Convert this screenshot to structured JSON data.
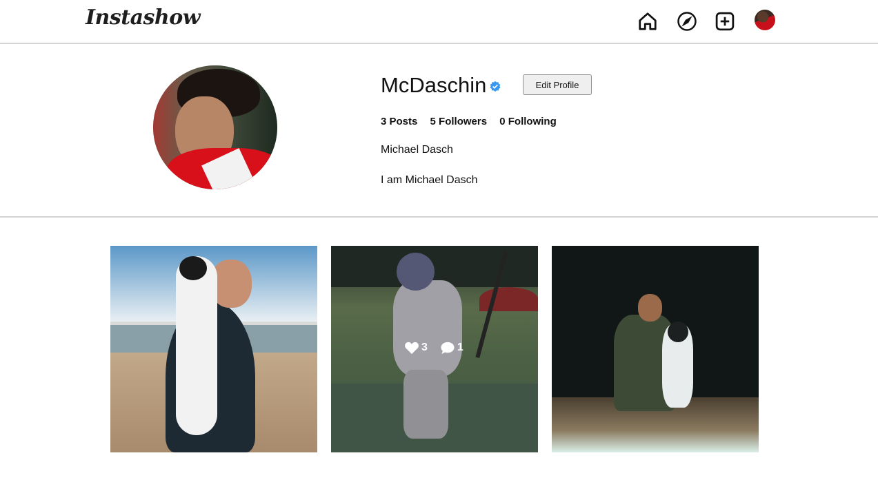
{
  "app": {
    "logo": "Instashow"
  },
  "nav": {
    "items": [
      {
        "name": "home",
        "icon": "home-icon"
      },
      {
        "name": "explore",
        "icon": "compass-icon"
      },
      {
        "name": "new-post",
        "icon": "plus-square-icon"
      },
      {
        "name": "profile",
        "icon": "avatar"
      }
    ]
  },
  "profile": {
    "username": "McDaschin",
    "verified": true,
    "edit_label": "Edit Profile",
    "stats": {
      "posts": "3 Posts",
      "followers": "5 Followers",
      "following": "0 Following"
    },
    "full_name": "Michael Dasch",
    "bio": "I am Michael Dasch"
  },
  "posts": [
    {
      "id": "post-1",
      "hovered": false
    },
    {
      "id": "post-2",
      "hovered": true,
      "likes": "3",
      "comments": "1"
    },
    {
      "id": "post-3",
      "hovered": false
    }
  ],
  "colors": {
    "verified_badge": "#3897f0",
    "divider": "#d4d4d4"
  }
}
